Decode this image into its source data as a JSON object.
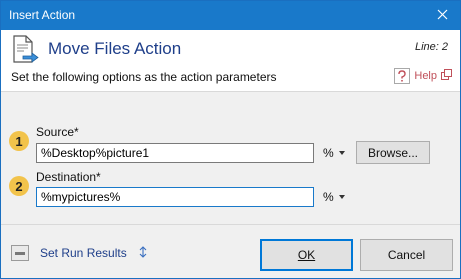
{
  "window": {
    "title": "Insert Action",
    "close_icon": "close-icon"
  },
  "header": {
    "action_title": "Move Files Action",
    "line_label": "Line: 2",
    "subtitle": "Set the following options as the action parameters",
    "help_label": "Help",
    "icons": [
      "document-arrow-icon",
      "help-question-icon",
      "popout-icon"
    ]
  },
  "fields": {
    "source": {
      "number": "1",
      "label": "Source*",
      "value": "%Desktop%picture1",
      "variable_button": "%",
      "browse_button": "Browse..."
    },
    "destination": {
      "number": "2",
      "label": "Destination*",
      "value": "%mypictures%",
      "variable_button": "%"
    }
  },
  "footer": {
    "run_results_label": "Set Run Results",
    "ok_label": "OK",
    "cancel_label": "Cancel"
  },
  "colors": {
    "titlebar": "#1979ca",
    "accent_text": "#1f3f8a",
    "field_number_badge": "#f2c34b",
    "help_text": "#c0505a"
  }
}
